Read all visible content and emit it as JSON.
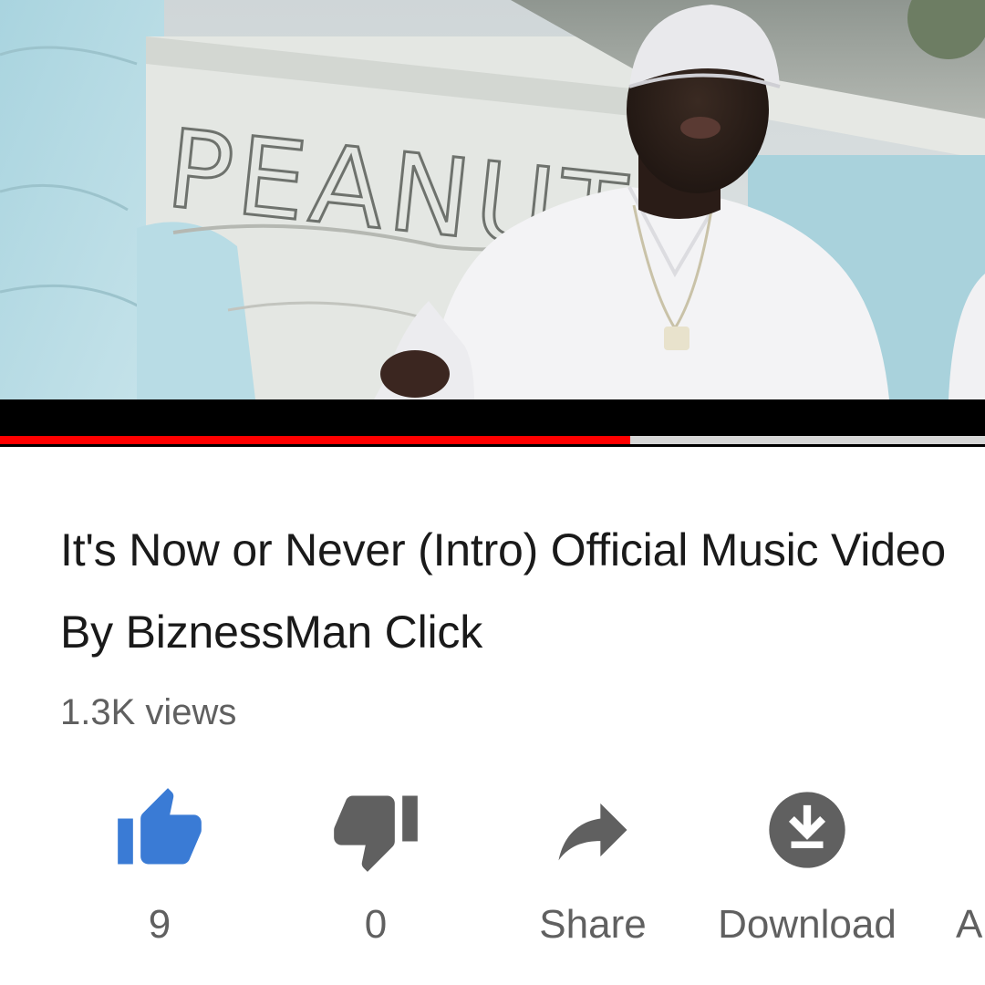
{
  "video": {
    "playback_progress": 0.64,
    "wall_text": "PEANUT"
  },
  "info": {
    "title": "It's Now or Never (Intro) Official Music Video By BiznessMan Click",
    "views": "1.3K views"
  },
  "actions": [
    {
      "id": "like",
      "label": "9",
      "icon": "thumbs-up-icon",
      "color": "#3a7bd5",
      "active": true
    },
    {
      "id": "dislike",
      "label": "0",
      "icon": "thumbs-down-icon",
      "color": "#606060",
      "active": false
    },
    {
      "id": "share",
      "label": "Share",
      "icon": "share-icon",
      "color": "#606060"
    },
    {
      "id": "download",
      "label": "Download",
      "icon": "download-icon",
      "color": "#606060"
    },
    {
      "id": "more",
      "label": "A",
      "icon": "",
      "color": "#606060"
    }
  ],
  "colors": {
    "progress_played": "#ff0000",
    "progress_buffered": "#d6d6d6",
    "title_text": "#1a1a1a",
    "secondary_text": "#606060",
    "like_active": "#3a7bd5"
  }
}
